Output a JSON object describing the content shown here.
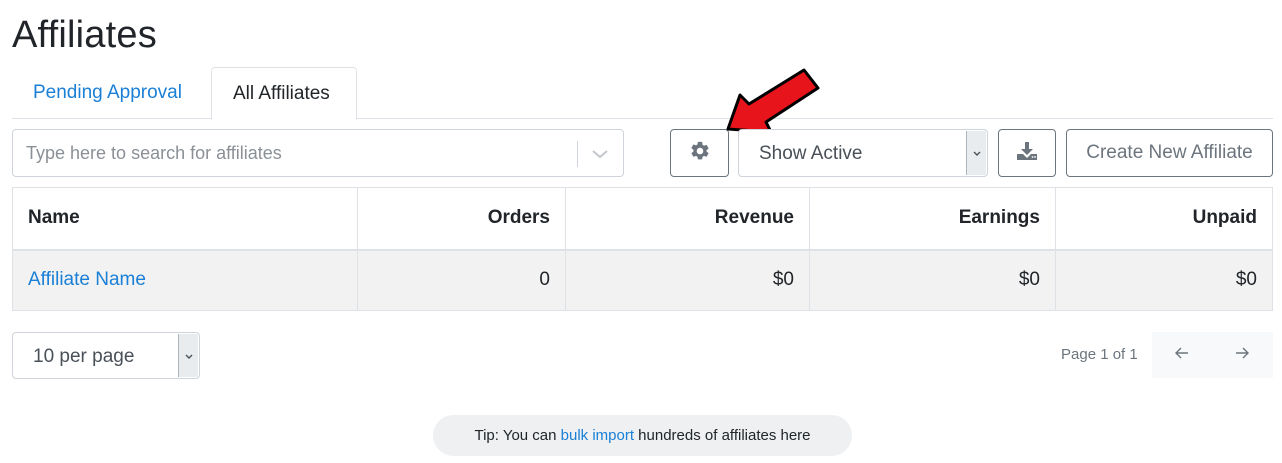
{
  "page": {
    "title": "Affiliates"
  },
  "tabs": [
    {
      "label": "Pending Approval",
      "active": false
    },
    {
      "label": "All Affiliates",
      "active": true
    }
  ],
  "toolbar": {
    "search_placeholder": "Type here to search for affiliates",
    "settings_icon": "gear-icon",
    "status_filter": {
      "selected": "Show Active"
    },
    "download_icon": "download-icon",
    "create_label": "Create New Affiliate"
  },
  "annotation": {
    "color": "#e8141b",
    "icon": "red-arrow"
  },
  "table": {
    "columns": [
      "Name",
      "Orders",
      "Revenue",
      "Earnings",
      "Unpaid"
    ],
    "rows": [
      {
        "name": "Affiliate Name",
        "orders": "0",
        "revenue": "$0",
        "earnings": "$0",
        "unpaid": "$0"
      }
    ]
  },
  "pagination": {
    "per_page": "10 per page",
    "page_info": "Page 1 of 1",
    "prev_icon": "arrow-left-icon",
    "next_icon": "arrow-right-icon"
  },
  "tip": {
    "prefix": "Tip: You can ",
    "link": "bulk import",
    "suffix": " hundreds of affiliates here"
  },
  "colors": {
    "link": "#1a7fd6",
    "text": "#212529",
    "border": "#dee2e6",
    "row_bg": "#f2f2f2"
  }
}
